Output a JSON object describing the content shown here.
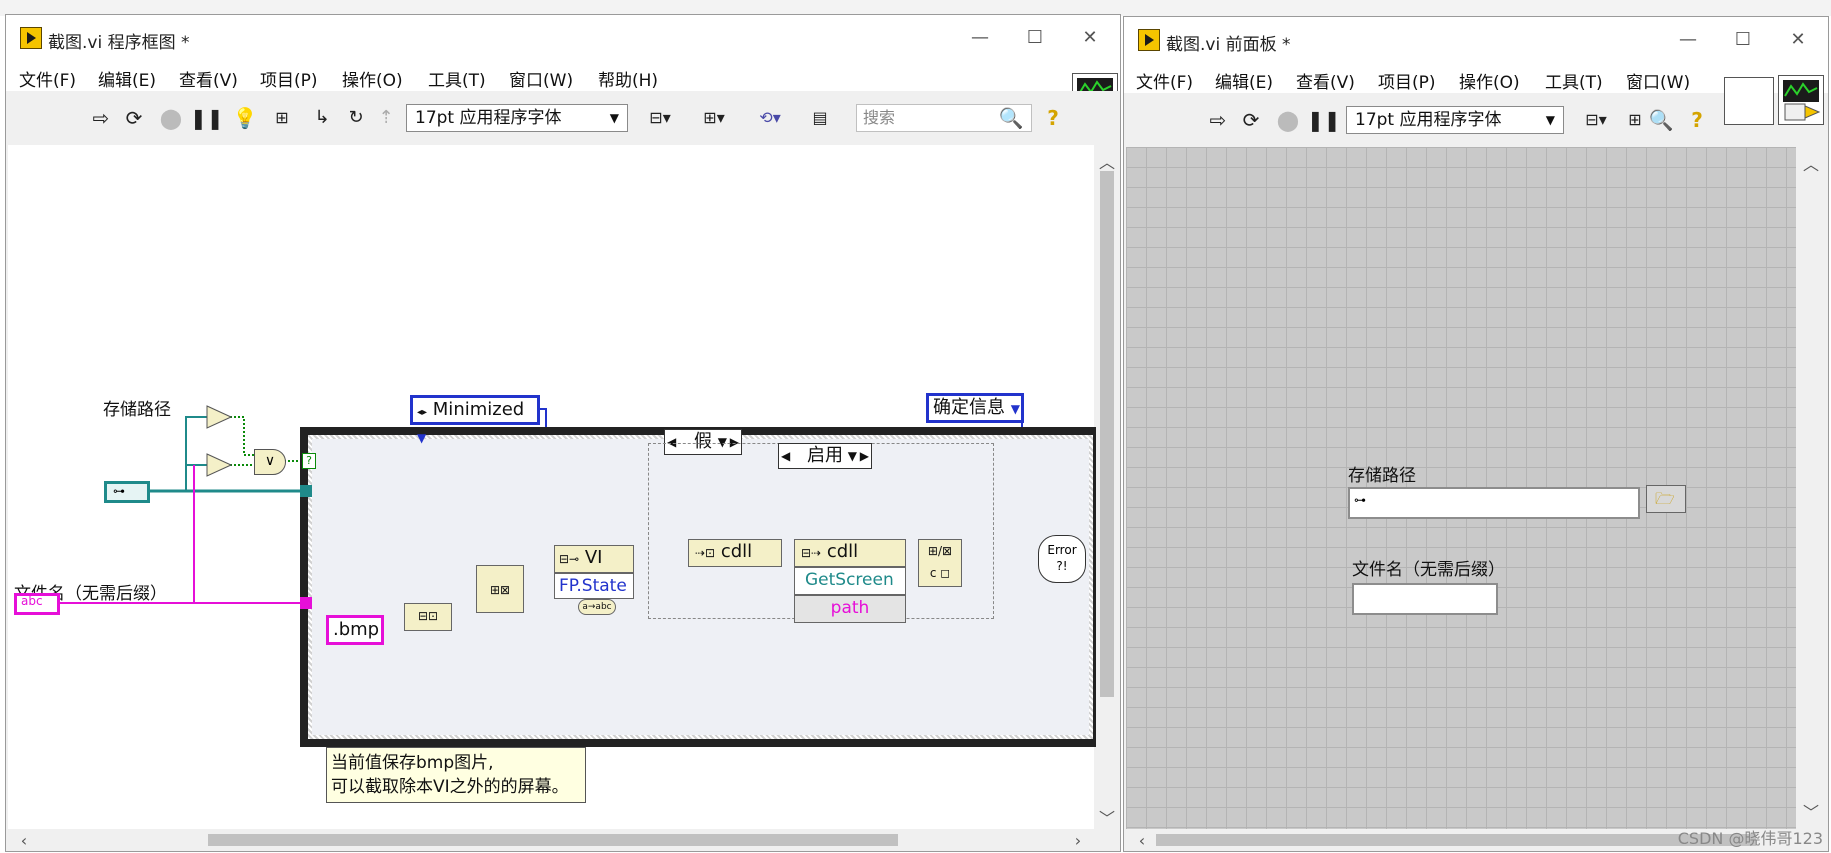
{
  "block_diagram_window": {
    "title": "截图.vi 程序框图 *",
    "menus": [
      "文件(F)",
      "编辑(E)",
      "查看(V)",
      "项目(P)",
      "操作(O)",
      "工具(T)",
      "窗口(W)",
      "帮助(H)"
    ],
    "font_selector": "17pt 应用程序字体",
    "search_placeholder": "搜索",
    "help_glyph": "?"
  },
  "diagram": {
    "control_storage_path_label": "存储路径",
    "control_filename_label": "文件名（无需后缀）",
    "filename_terminal_text": "abc",
    "or_gate_text": "∨",
    "case_selector_value": "假",
    "enum_minimized": "Minimized",
    "enum_confirm_info": "确定信息",
    "string_constant_bmp": ".bmp",
    "invoke_node_vi": "VI",
    "property_fp_state": "FP.State",
    "cdll_text": "cdll",
    "inner_case_selector": "启用",
    "getscreen_text": "GetScreen",
    "path_text": "path",
    "error_text": "Error",
    "comment_line1": "当前值保存bmp图片,",
    "comment_line2": "可以截取除本VI之外的的屏幕。"
  },
  "front_panel_window": {
    "title": "截图.vi 前面板 *",
    "menus": [
      "文件(F)",
      "编辑(E)",
      "查看(V)",
      "项目(P)",
      "操作(O)",
      "工具(T)",
      "窗口(W)"
    ],
    "font_selector": "17pt 应用程序字体",
    "help_glyph": "?"
  },
  "front_panel": {
    "path_label": "存储路径",
    "path_value": "",
    "filename_label": "文件名（无需后缀）",
    "filename_value": ""
  },
  "watermark": "CSDN @晓伟哥123",
  "colors": {
    "path_wire": "#1f8a8a",
    "string_wire": "#e60fd8",
    "enum_wire": "#2233cc",
    "cluster_wire": "#7a6a00"
  }
}
